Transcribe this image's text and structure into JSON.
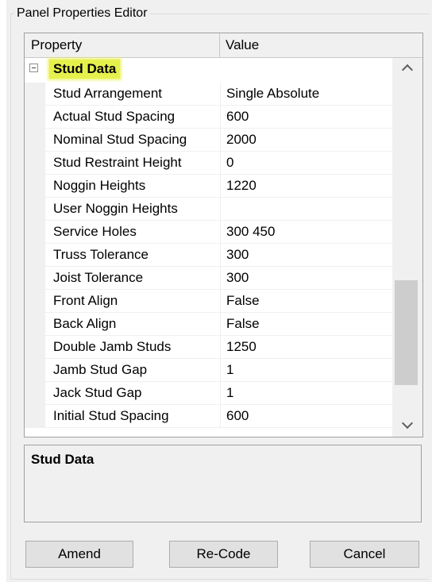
{
  "window": {
    "group_title": "Panel Properties Editor"
  },
  "grid": {
    "headers": {
      "property": "Property",
      "value": "Value"
    },
    "category": {
      "label": "Stud Data",
      "expanded": true,
      "highlight_color": "#e6f04d"
    },
    "rows": [
      {
        "name": "Stud Arrangement",
        "value": "Single Absolute"
      },
      {
        "name": "Actual Stud Spacing",
        "value": "600"
      },
      {
        "name": "Nominal Stud Spacing",
        "value": "2000"
      },
      {
        "name": "Stud Restraint Height",
        "value": "0"
      },
      {
        "name": "Noggin Heights",
        "value": "1220"
      },
      {
        "name": "User Noggin Heights",
        "value": ""
      },
      {
        "name": "Service Holes",
        "value": "300 450"
      },
      {
        "name": "Truss Tolerance",
        "value": "300"
      },
      {
        "name": "Joist Tolerance",
        "value": "300"
      },
      {
        "name": "Front Align",
        "value": "False"
      },
      {
        "name": "Back Align",
        "value": "False"
      },
      {
        "name": "Double Jamb Studs",
        "value": "1250"
      },
      {
        "name": "Jamb Stud Gap",
        "value": "1"
      },
      {
        "name": "Jack Stud Gap",
        "value": "1"
      },
      {
        "name": "Initial Stud Spacing",
        "value": "600"
      }
    ]
  },
  "description": {
    "title": "Stud Data"
  },
  "buttons": {
    "amend": "Amend",
    "recode": "Re-Code",
    "cancel": "Cancel"
  },
  "icons": {
    "collapse": "minus-square-icon",
    "scroll_up": "chevron-up-icon",
    "scroll_down": "chevron-down-icon"
  }
}
